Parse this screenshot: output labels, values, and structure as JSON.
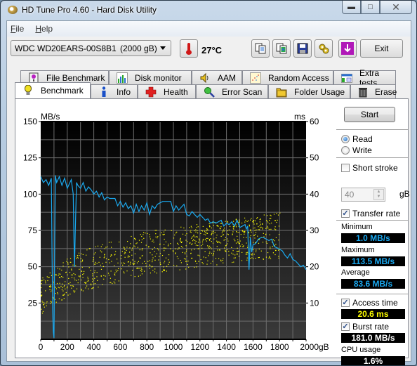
{
  "window": {
    "title": "HD Tune Pro 4.60 - Hard Disk Utility",
    "caption_buttons": [
      "minimize",
      "maximize",
      "close"
    ]
  },
  "menu": [
    {
      "label": "File",
      "accel": "F"
    },
    {
      "label": "Help",
      "accel": "H"
    }
  ],
  "toolbar": {
    "drive_name": "WDC WD20EARS-00S8B1",
    "drive_size": "(2000 gB)",
    "temperature": "27°C",
    "icon_buttons": [
      "copy-text-icon",
      "copy-screenshot-icon",
      "save-icon",
      "options-icon",
      "download-icon"
    ],
    "exit_label": "Exit"
  },
  "tabs": {
    "back_row": [
      {
        "label": "File Benchmark",
        "icon": "file-benchmark-icon"
      },
      {
        "label": "Disk monitor",
        "icon": "disk-monitor-icon"
      },
      {
        "label": "AAM",
        "icon": "speaker-icon"
      },
      {
        "label": "Random Access",
        "icon": "random-access-icon"
      },
      {
        "label": "Extra tests",
        "icon": "extra-tests-icon"
      }
    ],
    "front_row": [
      {
        "label": "Benchmark",
        "icon": "bulb-icon",
        "active": true
      },
      {
        "label": "Info",
        "icon": "info-icon"
      },
      {
        "label": "Health",
        "icon": "health-cross-icon"
      },
      {
        "label": "Error Scan",
        "icon": "magnifier-icon"
      },
      {
        "label": "Folder Usage",
        "icon": "folder-icon"
      },
      {
        "label": "Erase",
        "icon": "trash-icon"
      }
    ]
  },
  "side_panel": {
    "start_label": "Start",
    "mode_options": [
      {
        "label": "Read",
        "selected": true
      },
      {
        "label": "Write",
        "selected": false
      }
    ],
    "short_stroke": {
      "label": "Short stroke",
      "checked": false
    },
    "short_stroke_value": "40",
    "short_stroke_unit": "gB",
    "transfer_rate": {
      "label": "Transfer rate",
      "checked": true
    },
    "minimum_label": "Minimum",
    "minimum_value": "1.0 MB/s",
    "maximum_label": "Maximum",
    "maximum_value": "113.5 MB/s",
    "average_label": "Average",
    "average_value": "83.6 MB/s",
    "access_time": {
      "label": "Access time",
      "checked": true
    },
    "access_time_value": "20.6 ms",
    "burst_rate": {
      "label": "Burst rate",
      "checked": true
    },
    "burst_rate_value": "181.0 MB/s",
    "cpu_label": "CPU usage",
    "cpu_value": "1.6%"
  },
  "colors": {
    "transfer_line": "#1aa9ef",
    "access_points": "#ffff00",
    "plot_bg_top": "#000000",
    "plot_bg_bottom": "#3a3a3a",
    "grid": "#6e6e6e"
  },
  "chart_data": {
    "type": "line",
    "title": "",
    "xlabel": "gB",
    "ylabel_left": "MB/s",
    "ylabel_right": "ms",
    "xlim": [
      0,
      2000
    ],
    "ylim_left": [
      0,
      150
    ],
    "ylim_right": [
      0,
      60
    ],
    "x_ticks": [
      0,
      200,
      400,
      600,
      800,
      1000,
      1200,
      1400,
      1600,
      1800,
      2000
    ],
    "x_tick_labels": [
      "0",
      "200",
      "400",
      "600",
      "800",
      "1000",
      "1200",
      "1400",
      "1600",
      "1800",
      "2000gB"
    ],
    "y_left_ticks": [
      25,
      50,
      75,
      100,
      125,
      150
    ],
    "y_right_ticks": [
      10,
      20,
      30,
      40,
      50,
      60
    ],
    "grid": true,
    "series": [
      {
        "name": "Transfer rate (MB/s)",
        "axis": "left",
        "x": [
          0,
          20,
          40,
          60,
          80,
          85,
          90,
          95,
          100,
          110,
          120,
          140,
          160,
          180,
          200,
          230,
          245,
          250,
          255,
          260,
          270,
          280,
          300,
          320,
          340,
          360,
          380,
          400,
          420,
          440,
          460,
          480,
          500,
          520,
          540,
          560,
          580,
          600,
          620,
          640,
          660,
          680,
          700,
          720,
          740,
          760,
          780,
          800,
          820,
          840,
          860,
          880,
          900,
          920,
          940,
          960,
          980,
          1000,
          1020,
          1040,
          1060,
          1080,
          1100,
          1120,
          1140,
          1160,
          1180,
          1200,
          1220,
          1240,
          1260,
          1280,
          1300,
          1320,
          1340,
          1360,
          1380,
          1400,
          1420,
          1440,
          1460,
          1480,
          1500,
          1520,
          1540,
          1550,
          1560,
          1570,
          1580,
          1590,
          1600,
          1620,
          1640,
          1660,
          1680,
          1700,
          1720,
          1740,
          1760,
          1780,
          1800,
          1820,
          1840,
          1860,
          1880,
          1900,
          1920,
          1940,
          1960,
          1980,
          2000
        ],
        "values": [
          112,
          108,
          110,
          106,
          111,
          60,
          20,
          5,
          1,
          113,
          108,
          112,
          106,
          111,
          104,
          110,
          100,
          70,
          50,
          72,
          108,
          106,
          104,
          108,
          102,
          105,
          103,
          100,
          102,
          98,
          101,
          96,
          98,
          97,
          97,
          97,
          92,
          95,
          91,
          94,
          90,
          92,
          87,
          93,
          88,
          92,
          89,
          94,
          86,
          92,
          90,
          93,
          94,
          95,
          95,
          95,
          95,
          88,
          92,
          89,
          91,
          93,
          86,
          85,
          88,
          86,
          84,
          86,
          84,
          82,
          83,
          80,
          81,
          80,
          81,
          82,
          78,
          80,
          79,
          81,
          78,
          82,
          77,
          78,
          79,
          76,
          78,
          48,
          70,
          60,
          65,
          66,
          69,
          70,
          70,
          69,
          68,
          69,
          64,
          63,
          62,
          61,
          58,
          56,
          59,
          55,
          54,
          52,
          50,
          51,
          48
        ]
      },
      {
        "name": "Access time (ms)",
        "axis": "right",
        "kind": "scatter",
        "note": "scattered yellow points; band rises from ~10-20 ms at 0 gB to ~20-34 ms at 1800 gB",
        "band_low": [
          [
            0,
            7
          ],
          [
            200,
            12
          ],
          [
            400,
            14
          ],
          [
            600,
            16
          ],
          [
            800,
            18
          ],
          [
            1000,
            19
          ],
          [
            1200,
            20
          ],
          [
            1400,
            21
          ],
          [
            1600,
            22
          ],
          [
            1800,
            22
          ]
        ],
        "band_high": [
          [
            0,
            17
          ],
          [
            200,
            23
          ],
          [
            400,
            26
          ],
          [
            600,
            28
          ],
          [
            800,
            30
          ],
          [
            1000,
            31
          ],
          [
            1200,
            32
          ],
          [
            1400,
            33
          ],
          [
            1600,
            34
          ],
          [
            1800,
            35
          ]
        ],
        "point_count": 900
      }
    ]
  }
}
